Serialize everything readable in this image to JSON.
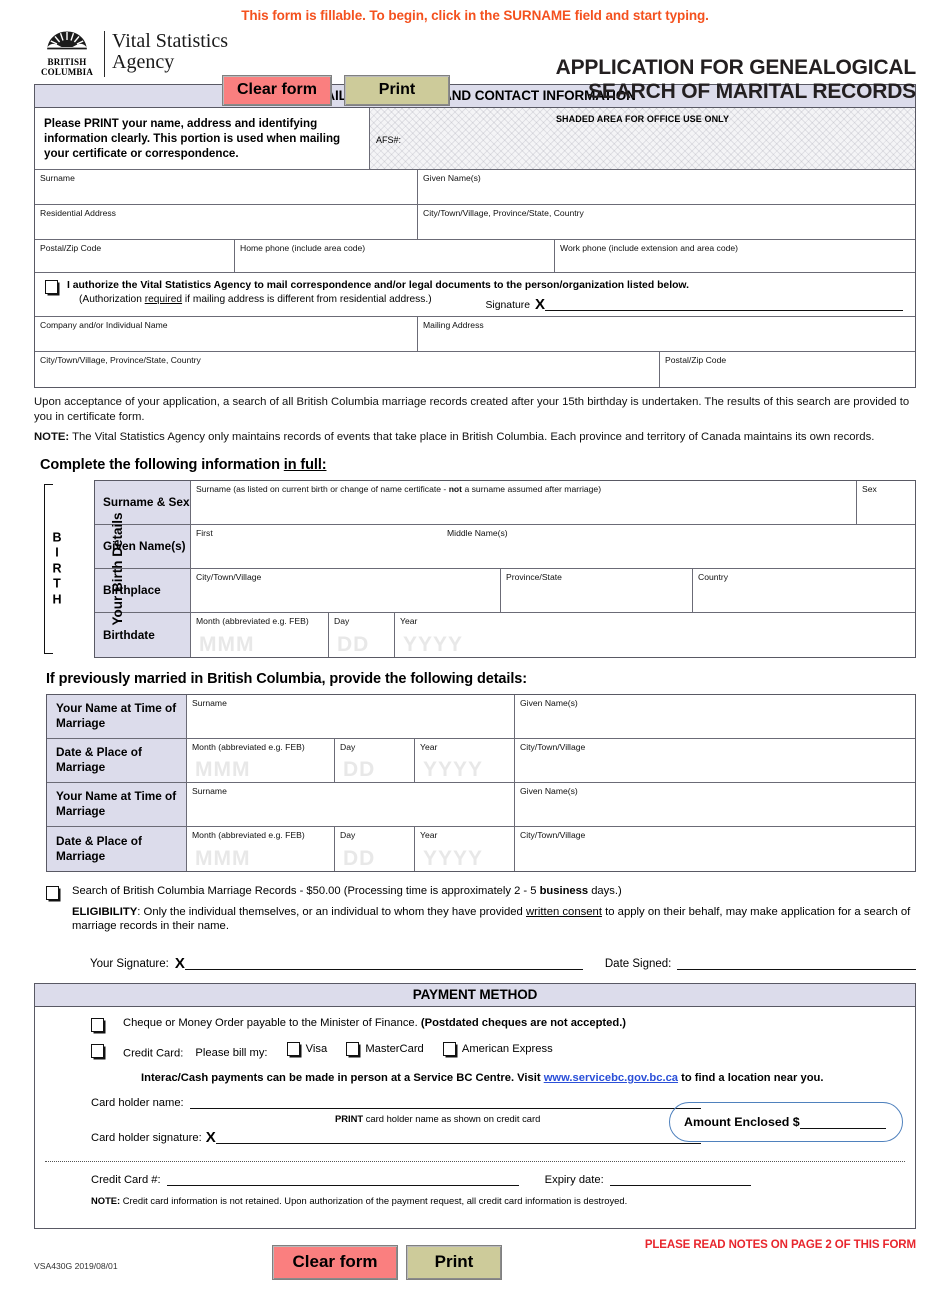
{
  "top_note": "This form is fillable. To begin, click in the SURNAME field and start typing.",
  "brand": {
    "logo_line1": "British",
    "logo_line2": "Columbia",
    "agency_line1": "Vital Statistics",
    "agency_line2": "Agency",
    "logo_icon": "bc-sun-mountain-logo"
  },
  "buttons": {
    "clear": "Clear form",
    "print": "Print",
    "clear_color": "#fa7f7f",
    "print_color": "#cdcb9a"
  },
  "title": {
    "line1": "APPLICATION FOR GENEALOGICAL",
    "line2": "SEARCH OF MARITAL RECORDS"
  },
  "mailing": {
    "band": "MAILING ADDRESS AND CONTACT INFORMATION",
    "intro": "Please PRINT your name, address and identifying information clearly. This portion is used when mailing your certificate or correspondence.",
    "office_title": "SHADED AREA FOR OFFICE USE ONLY",
    "afs": "AFS#:",
    "surname": "Surname",
    "given_names": "Given Name(s)",
    "residential_address": "Residential Address",
    "city_prov_country": "City/Town/Village, Province/State, Country",
    "postal": "Postal/Zip Code",
    "home_phone": "Home phone (include area code)",
    "work_phone": "Work phone (include extension and area code)"
  },
  "authorization": {
    "line1": "I authorize the Vital Statistics Agency to mail correspondence and/or legal documents to the person/organization listed below.",
    "line2_a": "(Authorization ",
    "line2_u": "required",
    "line2_b": " if mailing address is different from residential address.)",
    "signature_label": "Signature",
    "signature_x": "X",
    "company_name": "Company and/or Individual Name",
    "mailing_address": "Mailing Address",
    "city_prov_country": "City/Town/Village, Province/State, Country",
    "postal": "Postal/Zip Code"
  },
  "paragraphs": {
    "upon": "Upon acceptance of your application, a search of all British Columbia marriage records created after your 15th birthday is undertaken. The results of this search are provided to you in certificate form.",
    "note_label": "NOTE:",
    "note_text": " The Vital Statistics Agency only maintains records of events that take place in British Columbia. Each province and territory of Canada maintains its own records.",
    "complete_a": "Complete the following information ",
    "complete_u": "in full:"
  },
  "birth": {
    "side_letters": "B\nI\nR\nT\nH",
    "side_rotated": "Your Birth Details",
    "rows": [
      {
        "label": "Surname & Sex",
        "field1": "Surname (as listed on current birth or change of name certificate - ",
        "field1_bold": "not",
        "field1_end": " a surname assumed after marriage)",
        "sex": "Sex"
      },
      {
        "label": "Given Name(s)",
        "first": "First",
        "middle": "Middle Name(s)"
      },
      {
        "label": "Birthplace",
        "city": "City/Town/Village",
        "province": "Province/State",
        "country": "Country"
      },
      {
        "label": "Birthdate",
        "month": "Month (abbreviated e.g. FEB)",
        "day": "Day",
        "year": "Year",
        "ph_month": "MMM",
        "ph_day": "DD",
        "ph_year": "YYYY"
      }
    ]
  },
  "marriage": {
    "heading": "If previously married in British Columbia, provide the following details:",
    "name_label": "Your Name at Time of Marriage",
    "date_label": "Date & Place of Marriage",
    "surname": "Surname",
    "given_names": "Given Name(s)",
    "month": "Month (abbreviated e.g. FEB)",
    "day": "Day",
    "year": "Year",
    "city": "City/Town/Village",
    "ph_month": "MMM",
    "ph_day": "DD",
    "ph_year": "YYYY"
  },
  "eligibility": {
    "search_a": "Search of British Columbia Marriage Records - $50.00 (Processing time is approximately 2 - 5 ",
    "search_bold": "business",
    "search_b": " days.)",
    "label": "ELIGIBILITY",
    "text_a": ": Only the individual themselves, or an individual to whom they have provided ",
    "text_u": "written consent",
    "text_b": " to apply on their behalf, may make application for a search of marriage records in their name.",
    "your_signature": "Your Signature:",
    "signature_x": "X",
    "date_signed": "Date Signed:"
  },
  "payment": {
    "band": "PAYMENT METHOD",
    "cheque_a": "Cheque or Money Order payable to the Minister of Finance. ",
    "cheque_bold": "(Postdated cheques are not accepted.)",
    "credit_card": "Credit Card:",
    "bill_my": "Please bill my:",
    "visa": "Visa",
    "mastercard": "MasterCard",
    "amex": "American Express",
    "interac_a": "Interac/Cash payments can be made in person at a Service BC Centre. Visit ",
    "interac_link": "www.servicebc.gov.bc.ca",
    "interac_b": " to find a location near you.",
    "card_holder_name": "Card holder name:",
    "print_note_bold": "PRINT",
    "print_note": " card holder name as shown on credit card",
    "card_holder_signature": "Card holder signature:",
    "signature_x": "X",
    "amount_enclosed": "Amount Enclosed $",
    "amount_box_color": "#4f81bd",
    "credit_card_num": "Credit Card #:",
    "expiry": "Expiry date:",
    "note_label": "NOTE:",
    "note_text": " Credit card information is not retained. Upon authorization of the payment request, all credit card information is destroyed."
  },
  "footer": {
    "code": "VSA430G 2019/08/01",
    "read_notes": "PLEASE READ NOTES ON PAGE 2 OF THIS FORM"
  }
}
